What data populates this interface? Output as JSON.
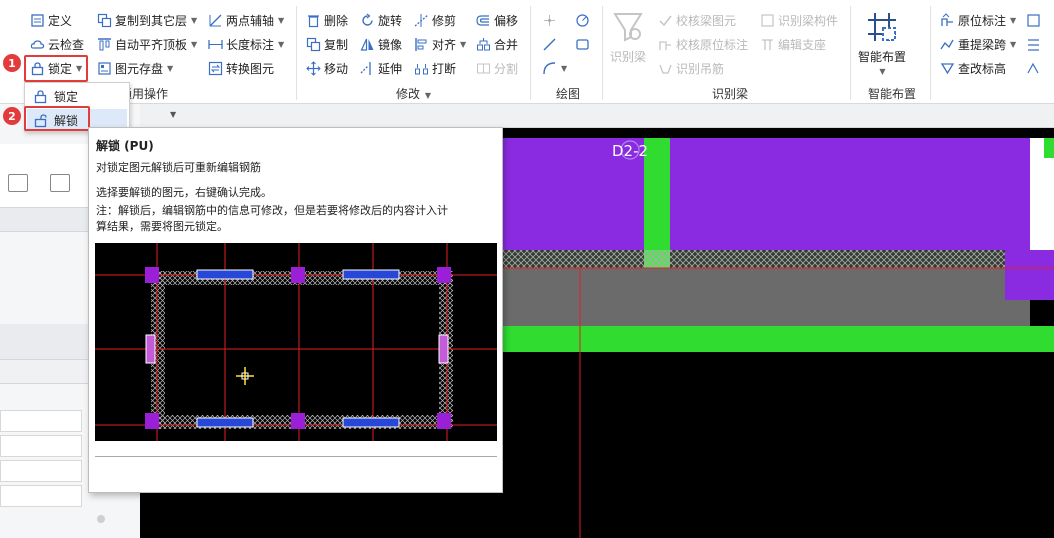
{
  "ribbon": {
    "col1": {
      "define": "定义",
      "cloud_check": "云检查",
      "lock": "锁定"
    },
    "col2": {
      "copy_to_layer": "复制到其它层",
      "auto_align_top": "自动平齐顶板",
      "element_storage": "图元存盘",
      "group_label": "通用操作"
    },
    "col3": {
      "two_point_axis": "两点辅轴",
      "length_dim": "长度标注",
      "convert_element": "转换图元"
    },
    "modify": {
      "delete": "删除",
      "rotate": "旋转",
      "trim": "修剪",
      "offset": "偏移",
      "copy": "复制",
      "mirror": "镜像",
      "align": "对齐",
      "merge": "合并",
      "move": "移动",
      "extend": "延伸",
      "break": "打断",
      "split": "分割",
      "group_label": "修改"
    },
    "draw": {
      "group_label": "绘图"
    },
    "identify_beam": {
      "identify_beam_btn": "识别梁",
      "check_beam_element": "校核梁图元",
      "check_original_dim": "校核原位标注",
      "identify_rebar": "识别吊筋",
      "identify_beam_member": "识别梁构件",
      "edit_support": "编辑支座",
      "group_label": "识别梁"
    },
    "smart_layout": {
      "btn": "智能布置",
      "group_label": "智能布置"
    },
    "right": {
      "original_dim": "原位标注",
      "reextract_span": "重提梁跨",
      "check_elevation": "查改标高"
    }
  },
  "dropdown": {
    "lock_item": "锁定",
    "unlock_item": "解锁"
  },
  "badges": {
    "step1": "1",
    "step2": "2"
  },
  "tooltip": {
    "title": "解锁 (PU)",
    "desc": "对锁定图元解锁后可重新编辑钢筋",
    "step": "选择要解锁的图元，右键确认完成。",
    "note1": "注：解锁后，编辑钢筋中的信息可修改，但是若要将修改后的内容计入计",
    "note2": "算结果，需要将图元锁定。"
  },
  "canvas": {
    "beam_label": "D2-2"
  },
  "colors": {
    "accent_red": "#e23b3b",
    "beam_purple": "#8a2be2",
    "green": "#2fdc2f",
    "canvas_bg": "#000000"
  }
}
